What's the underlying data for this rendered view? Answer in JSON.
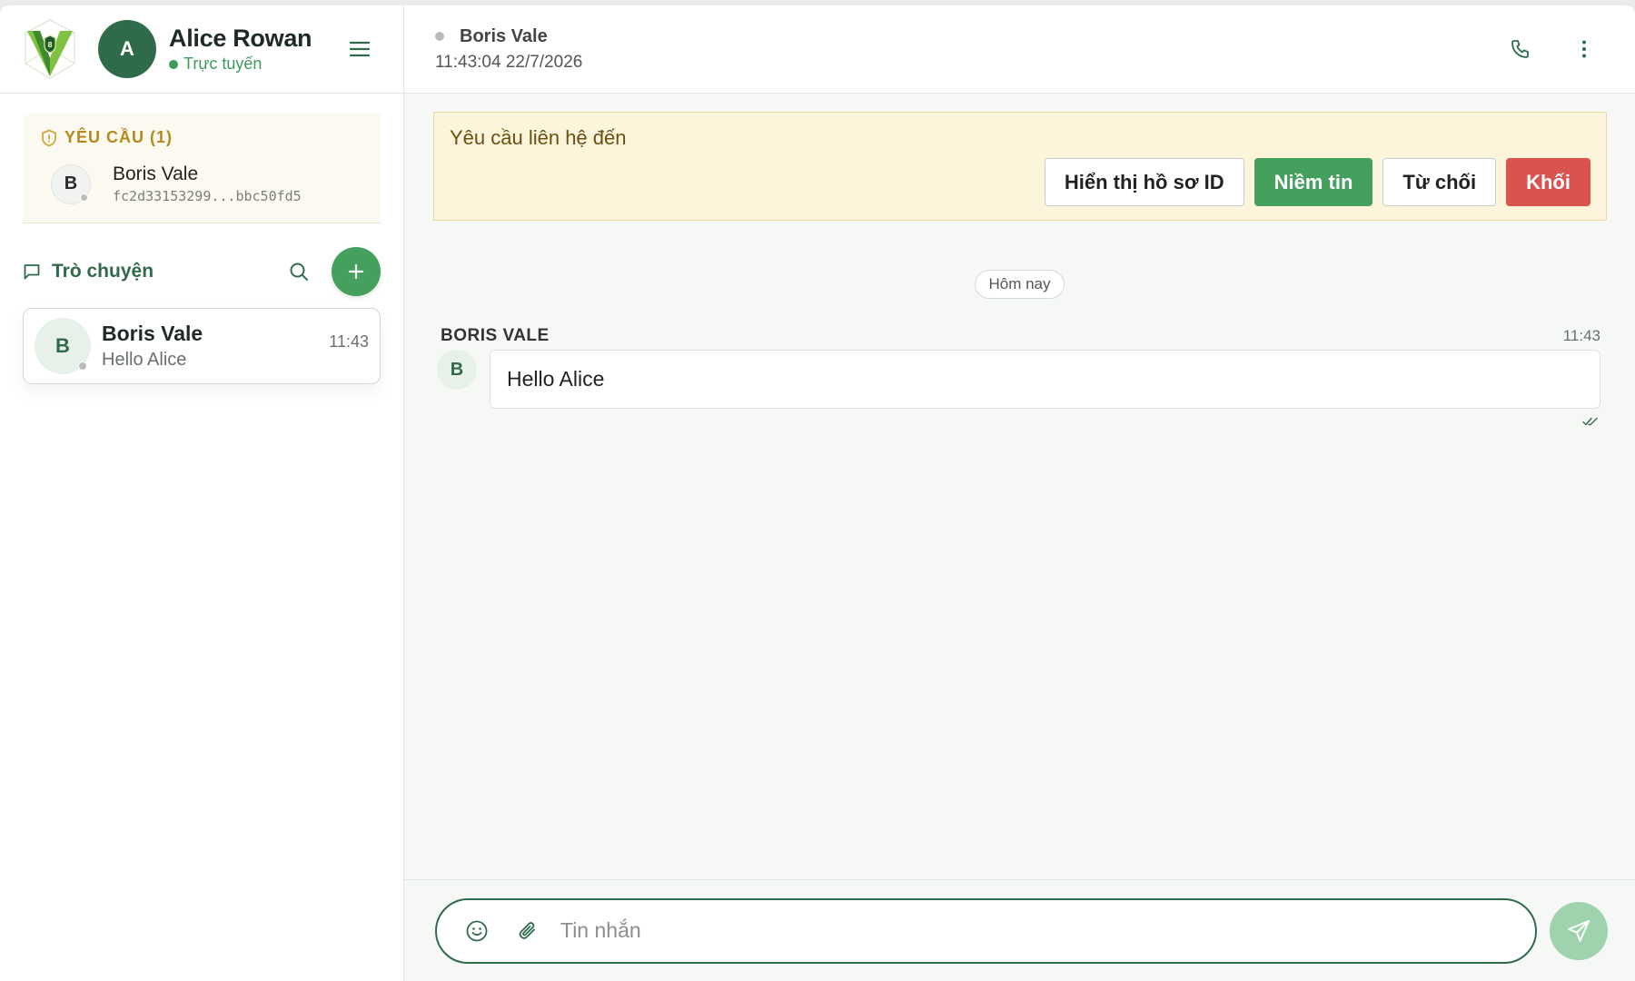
{
  "user": {
    "avatar_letter": "A",
    "name": "Alice Rowan",
    "status": "Trực tuyến"
  },
  "requests": {
    "title": "YÊU CẦU (1)",
    "items": [
      {
        "avatar_letter": "B",
        "name": "Boris Vale",
        "id": "fc2d33153299...bbc50fd5"
      }
    ]
  },
  "chats": {
    "title": "Trò chuyện",
    "items": [
      {
        "avatar_letter": "B",
        "name": "Boris Vale",
        "preview": "Hello Alice",
        "time": "11:43"
      }
    ]
  },
  "conversation": {
    "contact_name": "Boris Vale",
    "last_seen": "11:43:04 22/7/2026"
  },
  "banner": {
    "text": "Yêu cầu liên hệ đến",
    "show_id_label": "Hiển thị hồ sơ ID",
    "trust_label": "Niềm tin",
    "reject_label": "Từ chối",
    "block_label": "Khối"
  },
  "day_separator": "Hôm nay",
  "messages": [
    {
      "sender": "BORIS VALE",
      "avatar_letter": "B",
      "time": "11:43",
      "text": "Hello Alice"
    }
  ],
  "composer": {
    "placeholder": "Tin nhắn"
  },
  "colors": {
    "brand_green": "#2f6b4b",
    "accent_green": "#45a05e",
    "online_green": "#3e9a5a",
    "danger_red": "#d9534f",
    "request_gold": "#b48a1c",
    "banner_bg": "#fdf4dc"
  },
  "icons": {
    "logo": "shield-v-logo",
    "menu": "hamburger-icon",
    "request": "shield-icon",
    "chat": "chat-bubble-icon",
    "search": "search-icon",
    "add": "plus-icon",
    "call": "phone-icon",
    "more": "more-vertical-icon",
    "emoji": "smiley-icon",
    "attach": "paperclip-icon",
    "send": "send-icon",
    "read": "double-check-icon"
  }
}
